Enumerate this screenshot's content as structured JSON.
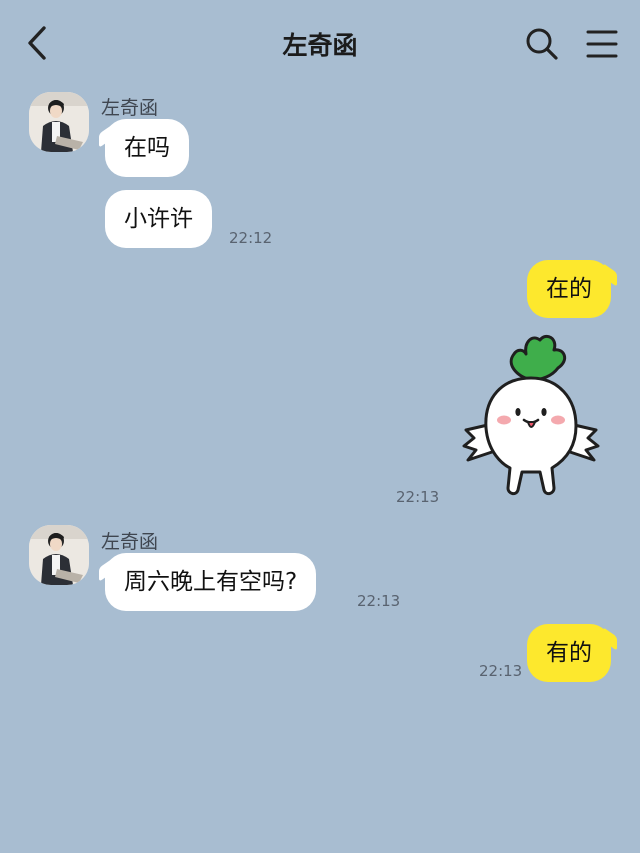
{
  "header": {
    "title": "左奇函",
    "back_icon": "chevron-left-icon",
    "search_icon": "search-icon",
    "menu_icon": "hamburger-menu-icon"
  },
  "colors": {
    "background": "#a8bdd1",
    "incoming_bubble": "#ffffff",
    "outgoing_bubble": "#fde82d"
  },
  "messages": [
    {
      "direction": "in",
      "sender": "左奇函",
      "text": "在吗",
      "time": ""
    },
    {
      "direction": "in",
      "sender": "",
      "text": "小许许",
      "time": "22:12"
    },
    {
      "direction": "out",
      "text": "在的",
      "time": ""
    },
    {
      "direction": "out",
      "type": "sticker",
      "sticker": "white-radish-sticker",
      "time": "22:13"
    },
    {
      "direction": "in",
      "sender": "左奇函",
      "text": "周六晚上有空吗?",
      "time": "22:13"
    },
    {
      "direction": "out",
      "text": "有的",
      "time": "22:13"
    }
  ]
}
